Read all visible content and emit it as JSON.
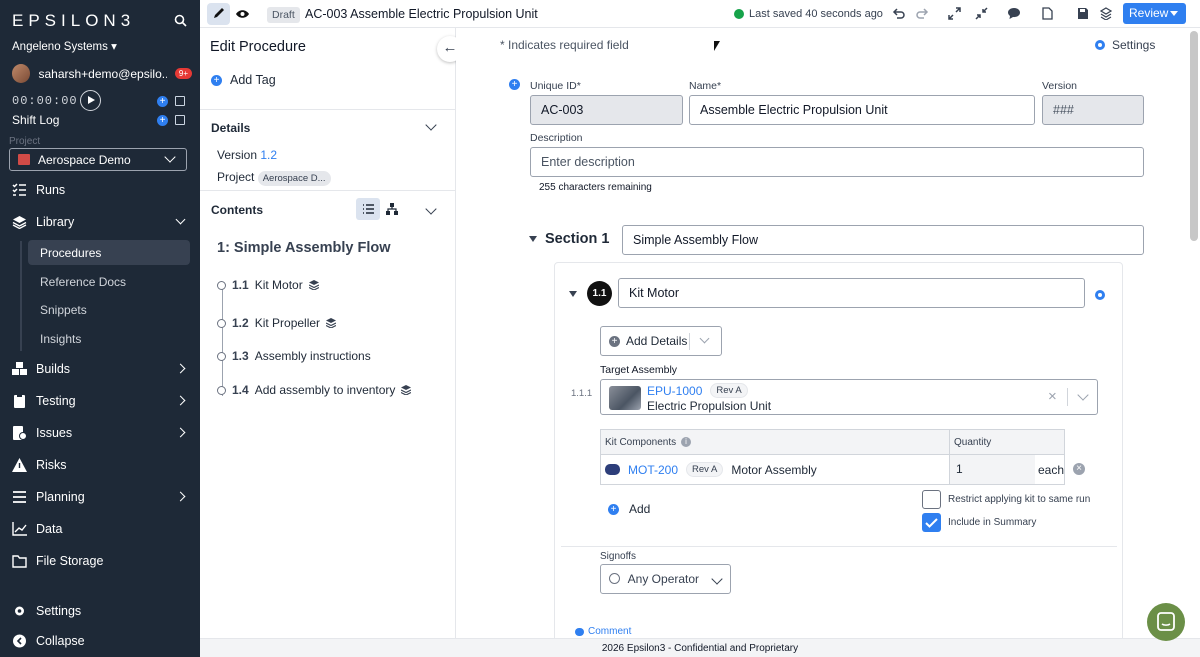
{
  "sidebar": {
    "logo": "EPSILON3",
    "org": "Angeleno Systems ▾",
    "user": "saharsh+demo@epsilo...",
    "notifications": "9+",
    "timer": "00:00:00",
    "shift_log": "Shift Log",
    "project_label": "Project",
    "project": "Aerospace Demo",
    "nav": {
      "runs": "Runs",
      "library": "Library",
      "builds": "Builds",
      "testing": "Testing",
      "issues": "Issues",
      "risks": "Risks",
      "planning": "Planning",
      "data": "Data",
      "file_storage": "File Storage",
      "settings": "Settings",
      "collapse": "Collapse"
    },
    "library_items": [
      "Procedures",
      "Reference Docs",
      "Snippets",
      "Insights"
    ]
  },
  "topbar": {
    "status": "Draft",
    "title": "AC-003 Assemble Electric Propulsion Unit",
    "saved": "Last saved 40 seconds ago",
    "review": "Review"
  },
  "panel": {
    "title": "Edit Procedure",
    "add_tag": "Add Tag",
    "details": "Details",
    "version_label": "Version",
    "version": "1.2",
    "project_label": "Project",
    "project": "Aerospace D...",
    "contents": "Contents",
    "procedure_title": "1: Simple Assembly Flow",
    "steps": [
      {
        "num": "1.1",
        "name": "Kit Motor"
      },
      {
        "num": "1.2",
        "name": "Kit Propeller"
      },
      {
        "num": "1.3",
        "name": "Assembly instructions"
      },
      {
        "num": "1.4",
        "name": "Add assembly to inventory"
      }
    ]
  },
  "main": {
    "required_note": "* Indicates required field",
    "settings": "Settings",
    "unique_id_label": "Unique ID*",
    "unique_id": "AC-003",
    "name_label": "Name*",
    "name": "Assemble Electric Propulsion Unit",
    "version_label": "Version",
    "version_placeholder": "###",
    "description_label": "Description",
    "description_placeholder": "Enter description",
    "remaining": "255 characters remaining",
    "section_label": "Section 1",
    "section_name": "Simple Assembly Flow",
    "step_number": "1.1",
    "step_name": "Kit Motor",
    "add_details": "Add Details",
    "target_assembly_label": "Target Assembly",
    "target_index": "1.1.1",
    "target_part": "EPU-1000",
    "target_rev": "Rev A",
    "target_desc": "Electric Propulsion Unit",
    "kit_components_header": "Kit Components",
    "quantity_header": "Quantity",
    "component_part": "MOT-200",
    "component_rev": "Rev A",
    "component_desc": "Motor Assembly",
    "component_qty": "1",
    "component_unit": "each",
    "add": "Add",
    "restrict_label": "Restrict applying kit to same run",
    "summary_label": "Include in Summary",
    "signoffs_label": "Signoffs",
    "signoff_value": "Any Operator",
    "comment": "Comment"
  },
  "footer": "2026 Epsilon3 - Confidential and Proprietary",
  "colors": {
    "accent": "#2f7ff0",
    "sidebar": "#1e2937"
  }
}
